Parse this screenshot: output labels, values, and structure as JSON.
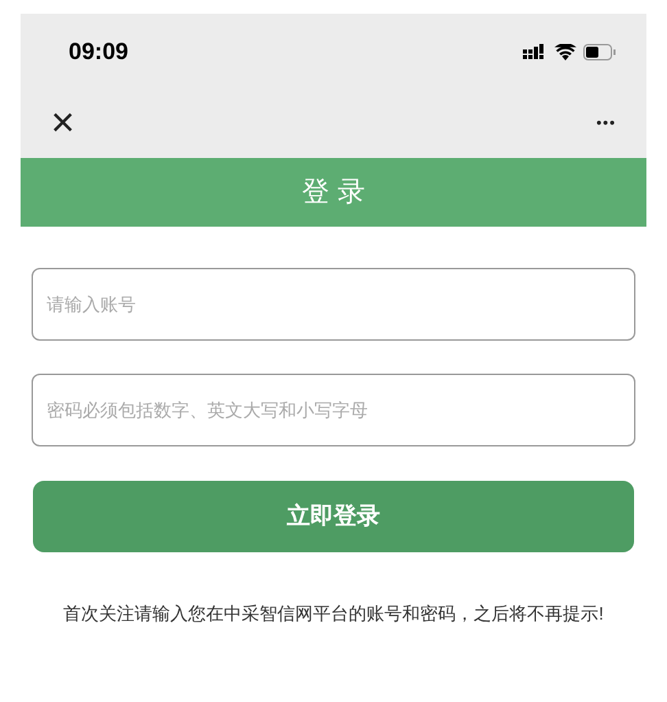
{
  "status_bar": {
    "time": "09:09"
  },
  "nav": {
    "close": "×",
    "more": "•••"
  },
  "header": {
    "title": "登 录"
  },
  "fields": [
    {
      "placeholder": "请输入账号"
    },
    {
      "placeholder": "密码必须包括数字、英文大写和小写字母"
    }
  ],
  "login_button": "立即登录",
  "note": "首次关注请输入您在中采智信网平台的账号和密码，之后将不再提示!"
}
